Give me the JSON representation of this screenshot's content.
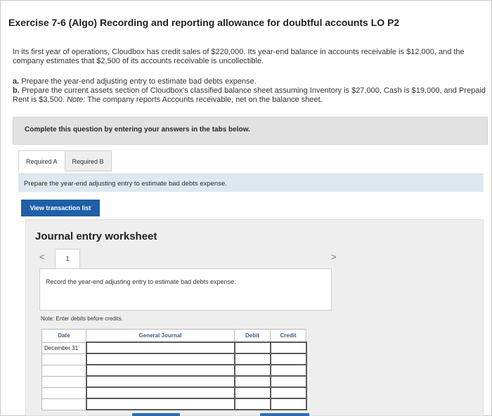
{
  "exercise": {
    "title": "Exercise 7-6 (Algo) Recording and reporting allowance for doubtful accounts LO P2",
    "intro": "In its first year of operations, Cloudbox has credit sales of $220,000. Its year-end balance in accounts receivable is $12,000, and the company estimates that $2,500 of its accounts receivable is uncollectible.",
    "req_a_letter": "a.",
    "req_a_text": " Prepare the year-end adjusting entry to estimate bad debts expense.",
    "req_b_letter": "b.",
    "req_b_text": " Prepare the current assets section of Cloudbox's classified balance sheet assuming Inventory is $27,000, Cash is $19,000, and Prepaid Rent is $3,500. ",
    "req_b_note_word": "Note:",
    "req_b_note_text": " The company reports Accounts receivable, net on the balance sheet."
  },
  "instructions": {
    "complete_label": "Complete this question by entering your answers in the tabs below."
  },
  "tabs": [
    {
      "label": "Required A",
      "active": true
    },
    {
      "label": "Required B",
      "active": false
    }
  ],
  "prepare": {
    "text": "Prepare the year-end adjusting entry to estimate bad debts expense."
  },
  "view_transactions_label": "View transaction list",
  "worksheet": {
    "title": "Journal entry worksheet",
    "prev_icon": "<",
    "next_icon": ">",
    "page_number": "1",
    "record_text": "Record the year-end adjusting entry to estimate bad debts expense.",
    "note": "Note: Enter debits before credits.",
    "columns": {
      "date": "Date",
      "general_journal": "General Journal",
      "debit": "Debit",
      "credit": "Credit"
    },
    "rows": [
      {
        "date": "December 31",
        "account": "",
        "debit": "",
        "credit": ""
      },
      {
        "date": "",
        "account": "",
        "debit": "",
        "credit": ""
      },
      {
        "date": "",
        "account": "",
        "debit": "",
        "credit": ""
      },
      {
        "date": "",
        "account": "",
        "debit": "",
        "credit": ""
      },
      {
        "date": "",
        "account": "",
        "debit": "",
        "credit": ""
      },
      {
        "date": "",
        "account": "",
        "debit": "",
        "credit": ""
      }
    ]
  },
  "colors": {
    "accent_button": "#1f5fa8",
    "header_text": "#355f8a",
    "prepare_bar": "#dde9ef"
  }
}
